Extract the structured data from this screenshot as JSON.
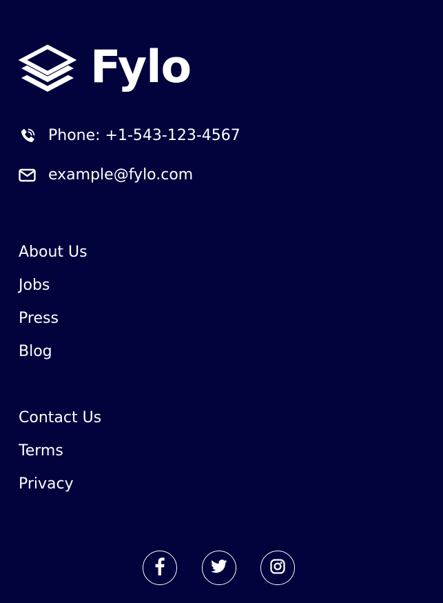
{
  "brand": {
    "name": "Fylo",
    "logo_icon": "stacked-layers-icon"
  },
  "contact": {
    "phone_label": "Phone: +1-543-123-4567",
    "phone_icon": "phone-icon",
    "email_label": "example@fylo.com",
    "email_icon": "envelope-icon"
  },
  "links_primary": [
    {
      "label": "About Us"
    },
    {
      "label": "Jobs"
    },
    {
      "label": "Press"
    },
    {
      "label": "Blog"
    }
  ],
  "links_secondary": [
    {
      "label": "Contact Us"
    },
    {
      "label": "Terms"
    },
    {
      "label": "Privacy"
    }
  ],
  "social": [
    {
      "icon": "facebook-icon"
    },
    {
      "icon": "twitter-icon"
    },
    {
      "icon": "instagram-icon"
    }
  ],
  "colors": {
    "background": "#02023d",
    "text": "#ffffff"
  }
}
